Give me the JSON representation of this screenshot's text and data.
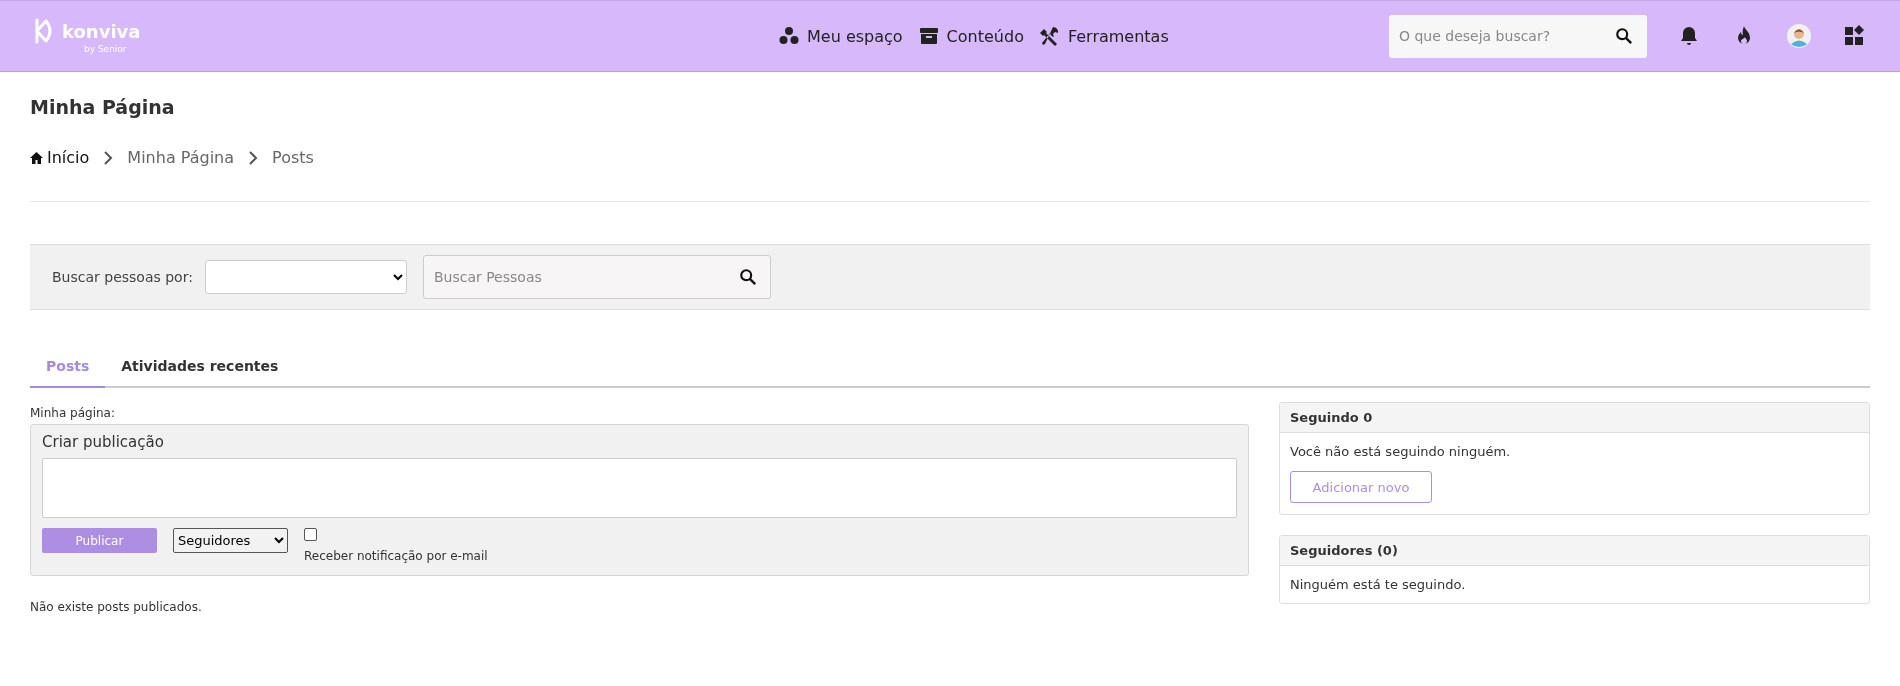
{
  "header": {
    "logo": {
      "name": "konviva",
      "tagline": "by Senior"
    },
    "nav": [
      {
        "label": "Meu espaço",
        "kind": "dots"
      },
      {
        "label": "Conteúdo",
        "kind": "archive"
      },
      {
        "label": "Ferramentas",
        "kind": "tools"
      }
    ],
    "search": {
      "placeholder": "O que deseja buscar?"
    }
  },
  "page_title": "Minha Página",
  "breadcrumb": [
    {
      "label": "Início",
      "kind": "home"
    },
    {
      "label": "Minha Página",
      "kind": "link"
    },
    {
      "label": "Posts",
      "kind": "link"
    }
  ],
  "people_search": {
    "label": "Buscar pessoas por:",
    "placeholder": "Buscar Pessoas"
  },
  "tabs": [
    {
      "label": "Posts",
      "selected": true
    },
    {
      "label": "Atividades recentes",
      "selected": false
    }
  ],
  "composer": {
    "label": "Minha página:",
    "title": "Criar publicação",
    "publish_button": "Publicar",
    "audience": "Seguidores",
    "email_notify": {
      "label": "Receber notificação por e-mail",
      "checked": false
    }
  },
  "empty_posts": "Não existe posts publicados.",
  "panels": [
    {
      "title": "Seguindo 0",
      "message": "Você não está seguindo ninguém.",
      "button": "Adicionar novo"
    },
    {
      "title": "Seguidores (0)",
      "message": "Ninguém está te seguindo."
    }
  ]
}
